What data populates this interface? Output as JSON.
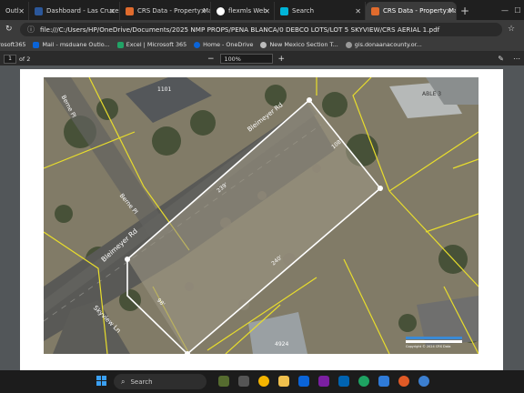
{
  "browser": {
    "tabs": [
      {
        "title": "Outl",
        "color": "#0a64d8",
        "active": false
      },
      {
        "title": "Dashboard - Las Cruces Ass",
        "color": "#2b579a",
        "active": false
      },
      {
        "title": "CRS Data - Property Map for - C",
        "color": "#e06b2d",
        "active": false
      },
      {
        "title": "flexmls Web",
        "color": "#ffffff",
        "active": false
      },
      {
        "title": "Search",
        "color": "#00b4d8",
        "active": false
      },
      {
        "title": "CRS Data - Property Map for - C",
        "color": "#e06b2d",
        "active": true
      }
    ],
    "new_tab": "+",
    "win_min": "—",
    "win_max": "☐",
    "url": "file:///C:/Users/HP/OneDrive/Documents/2025 NMP PROPS/PENA BLANCA/0 DEBCO LOTS/LOT 5 SKYVIEW/CRS AERIAL 1.pdf"
  },
  "bookmarks": [
    {
      "label": "rosoft365",
      "color": "#d83b01"
    },
    {
      "label": "Mail - msduane Outlo...",
      "color": "#0a64d8"
    },
    {
      "label": "Excel | Microsoft 365",
      "color": "#21a366"
    },
    {
      "label": "Home - OneDrive",
      "color": "#0a64d8"
    },
    {
      "label": "New Mexico Section T...",
      "color": "#888888"
    },
    {
      "label": "gis.donaanacounty.or...",
      "color": "#666666"
    }
  ],
  "pdf_toolbar": {
    "page_current": "1",
    "page_total": "of 2",
    "zoom_out": "−",
    "zoom_in": "+",
    "zoom": "100%"
  },
  "map": {
    "road_1": "Bleimeyer Rd",
    "road_2": "Bleimeyer Rd",
    "road_3": "Skyview Ln",
    "road_4": "Berne Pl",
    "road_5": "Berne Pl",
    "dim_front": "239'",
    "dim_side_right": "108'",
    "dim_back": "240'",
    "dim_side_left": "98'",
    "addr_1": "1101",
    "addr_2": "4924",
    "addr_3": "ABLE 3",
    "copyright": "Copyright © 2024 CRS Data"
  },
  "taskbar": {
    "search_label": "Search"
  }
}
